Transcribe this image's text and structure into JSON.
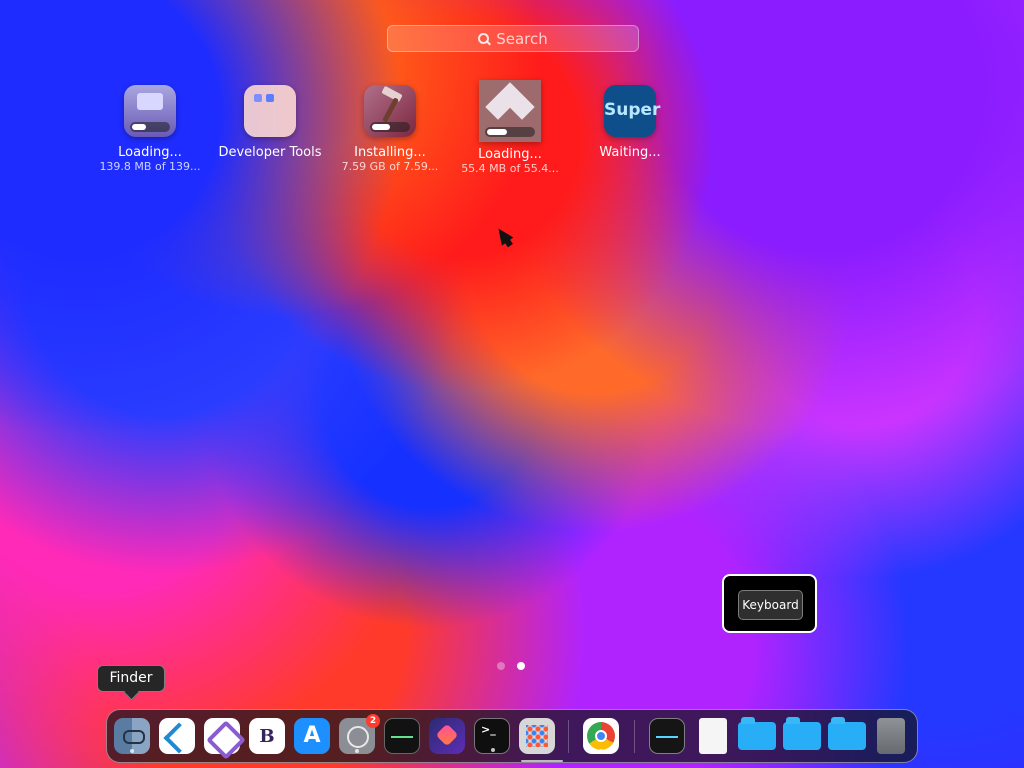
{
  "search": {
    "placeholder": "Search"
  },
  "apps": [
    {
      "label": "Loading...",
      "sub": "139.8 MB of 139...",
      "progress": 0.35,
      "icon": "installer-icon"
    },
    {
      "label": "Developer Tools",
      "sub": "",
      "progress": null,
      "icon": "folder-icon"
    },
    {
      "label": "Installing...",
      "sub": "7.59 GB of 7.59...",
      "progress": 0.45,
      "icon": "hammer-icon"
    },
    {
      "label": "Loading...",
      "sub": "55.4 MB of 55.4...",
      "progress": 0.4,
      "icon": "diamond-icon"
    },
    {
      "label": "Waiting...",
      "sub": "",
      "progress": null,
      "icon": "super-icon",
      "icon_text": "Super"
    }
  ],
  "page_indicator": {
    "total": 2,
    "active": 2
  },
  "keyboard_panel": {
    "label": "Keyboard"
  },
  "tooltip": {
    "label": "Finder"
  },
  "dock": {
    "items": [
      {
        "name": "finder-icon",
        "running": true
      },
      {
        "name": "vscode-icon",
        "running": false
      },
      {
        "name": "visual-studio-icon",
        "running": false
      },
      {
        "name": "bbedit-icon",
        "running": true
      },
      {
        "name": "app-store-icon",
        "running": false
      },
      {
        "name": "system-settings-icon",
        "running": true,
        "badge": "2"
      },
      {
        "name": "activity-monitor-icon",
        "running": false
      },
      {
        "name": "shortcuts-icon",
        "running": false
      },
      {
        "name": "terminal-icon",
        "running": true
      },
      {
        "name": "launchpad-icon",
        "running": true
      },
      {
        "name": "chrome-icon",
        "running": true
      },
      {
        "name": "activity-monitor-2-icon",
        "running": false
      },
      {
        "name": "document-icon",
        "running": false
      },
      {
        "name": "folder-icon-1",
        "running": false
      },
      {
        "name": "folder-icon-2",
        "running": false
      },
      {
        "name": "folder-icon-3",
        "running": false
      },
      {
        "name": "trash-icon",
        "running": false
      }
    ]
  }
}
